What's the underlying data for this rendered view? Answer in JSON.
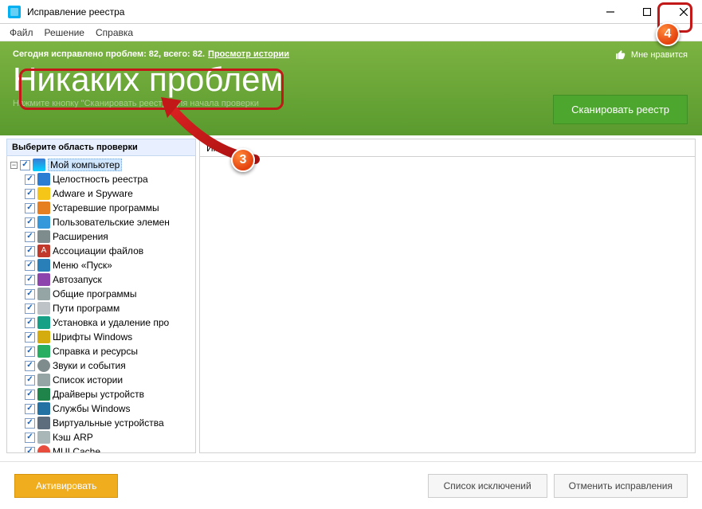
{
  "window": {
    "title": "Исправление реестра"
  },
  "menu": {
    "file": "Файл",
    "solution": "Решение",
    "help": "Справка"
  },
  "banner": {
    "status_prefix": "Сегодня исправлено проблем: 82, всего: 82.",
    "history_link": "Просмотр истории",
    "heading": "Никаких проблем",
    "subtext": "Нажмите кнопку \"Сканировать реестр\" для начала проверки",
    "like": "Мне нравится",
    "scan_btn": "Сканировать реестр"
  },
  "sidebar": {
    "title": "Выберите область проверки",
    "root": "Мой компьютер",
    "items": [
      {
        "icon": "integrity",
        "label": "Целостность реестра"
      },
      {
        "icon": "adware",
        "label": "Adware и Spyware"
      },
      {
        "icon": "old",
        "label": "Устаревшие программы"
      },
      {
        "icon": "user",
        "label": "Пользовательские элемен"
      },
      {
        "icon": "ext",
        "label": "Расширения"
      },
      {
        "icon": "assoc",
        "label": "Ассоциации файлов"
      },
      {
        "icon": "start",
        "label": "Меню «Пуск»"
      },
      {
        "icon": "startup",
        "label": "Автозапуск"
      },
      {
        "icon": "shared",
        "label": "Общие программы"
      },
      {
        "icon": "paths",
        "label": "Пути программ"
      },
      {
        "icon": "install",
        "label": "Установка и удаление про"
      },
      {
        "icon": "fonts",
        "label": "Шрифты Windows"
      },
      {
        "icon": "help",
        "label": "Справка и ресурсы"
      },
      {
        "icon": "sounds",
        "label": "Звуки и события"
      },
      {
        "icon": "history",
        "label": "Список истории"
      },
      {
        "icon": "drivers",
        "label": "Драйверы устройств"
      },
      {
        "icon": "services",
        "label": "Службы Windows"
      },
      {
        "icon": "virtual",
        "label": "Виртуальные устройства"
      },
      {
        "icon": "arp",
        "label": "Кэш ARP"
      },
      {
        "icon": "mui",
        "label": "MUI Cache"
      }
    ]
  },
  "list": {
    "header_name": "Имя"
  },
  "footer": {
    "activate": "Активировать",
    "exclusions": "Список исключений",
    "undo": "Отменить исправления"
  },
  "callouts": {
    "c3": "3",
    "c4": "4"
  }
}
